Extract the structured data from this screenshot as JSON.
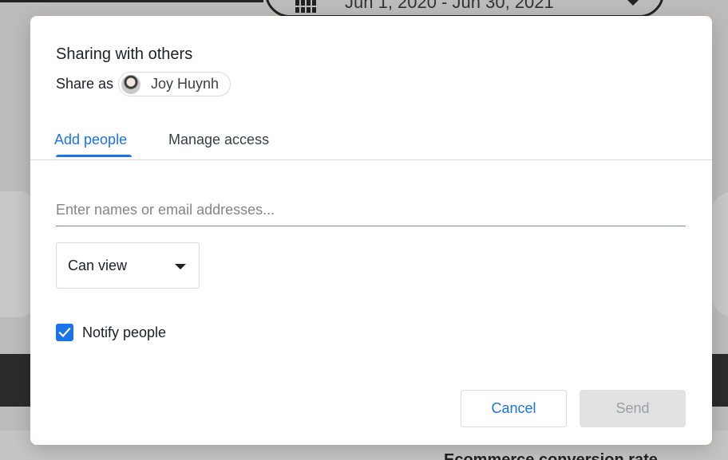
{
  "backdrop": {
    "date_range": "Jun 1, 2020 - Jun 30, 2021",
    "bottom_text": "Ecommerce conversion rate"
  },
  "dialog": {
    "title": "Sharing with others",
    "share_as_label": "Share as",
    "user_name": "Joy Huynh",
    "tabs": [
      {
        "label": "Add people",
        "active": true
      },
      {
        "label": "Manage access",
        "active": false
      }
    ],
    "people_input": {
      "placeholder": "Enter names or email addresses...",
      "value": ""
    },
    "permission": {
      "selected": "Can view"
    },
    "notify": {
      "label": "Notify people",
      "checked": true
    },
    "buttons": {
      "cancel": "Cancel",
      "send": "Send"
    }
  },
  "colors": {
    "accent": "#1a73e8",
    "overlay": "#bdbcba",
    "disabled_button": "#e2e2e2"
  }
}
